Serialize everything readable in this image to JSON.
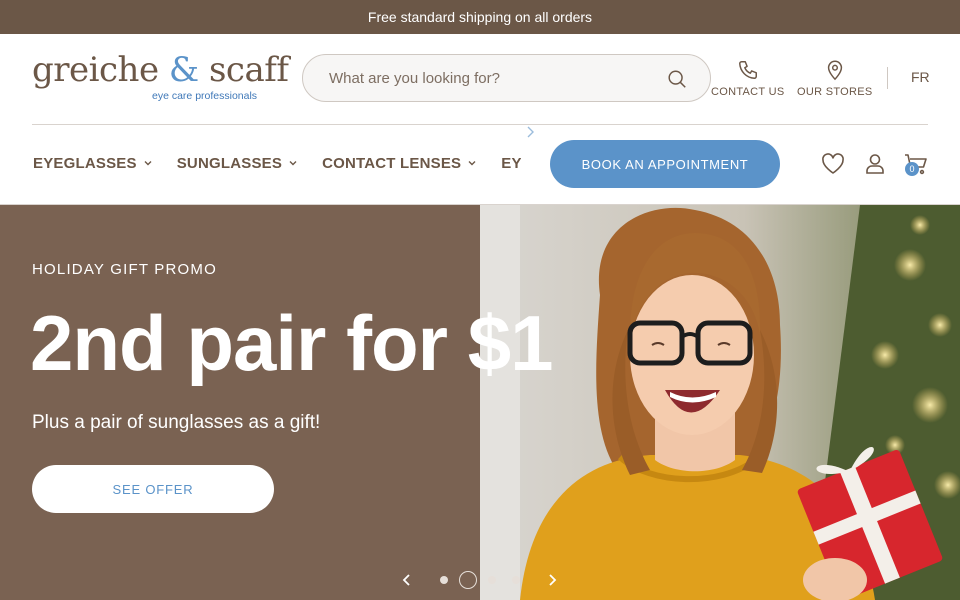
{
  "announcement": "Free standard shipping on all orders",
  "brand": {
    "name_left": "greiche",
    "ampersand": "&",
    "name_right": "scaff",
    "tagline": "eye care professionals"
  },
  "search": {
    "placeholder": "What are you looking for?",
    "value": ""
  },
  "utility": {
    "contact_label": "CONTACT US",
    "stores_label": "OUR STORES",
    "language": "FR"
  },
  "nav": {
    "items": [
      {
        "label": "EYEGLASSES"
      },
      {
        "label": "SUNGLASSES"
      },
      {
        "label": "CONTACT LENSES"
      },
      {
        "label": "EYECARE A"
      }
    ],
    "book_label": "BOOK AN APPOINTMENT",
    "cart_count": "0"
  },
  "hero": {
    "eyebrow": "HOLIDAY GIFT PROMO",
    "headline": "2nd pair for $1",
    "subline": "Plus a pair of sunglasses as a gift!",
    "cta": "SEE OFFER"
  },
  "carousel": {
    "slide_count": 4,
    "active_index": 1
  },
  "colors": {
    "brown": "#6b5747",
    "hero_brown": "#7a6252",
    "accent_blue": "#5b93c9",
    "sweater_yellow": "#e3a21a",
    "gift_red": "#d7262d"
  },
  "icons": [
    "search-icon",
    "phone-icon",
    "location-pin-icon",
    "heart-icon",
    "user-icon",
    "cart-icon",
    "chevron-down-icon",
    "chevron-left-icon",
    "chevron-right-icon"
  ]
}
